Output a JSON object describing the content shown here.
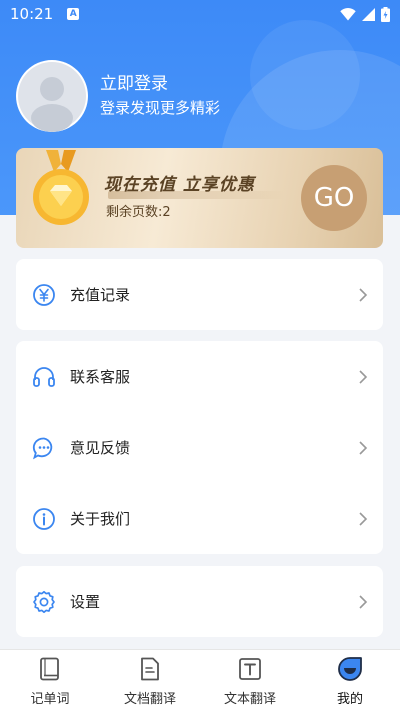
{
  "status_bar": {
    "time": "10:21",
    "notif_letter": "A"
  },
  "profile": {
    "title": "立即登录",
    "subtitle": "登录发现更多精彩"
  },
  "vip": {
    "headline": "现在充值 立享优惠",
    "pages_text": "剩余页数:2",
    "go_label": "GO"
  },
  "menu_card1": [
    {
      "label": "充值记录",
      "icon": "yen-circle-icon"
    }
  ],
  "menu_card2": [
    {
      "label": "联系客服",
      "icon": "headset-icon"
    },
    {
      "label": "意见反馈",
      "icon": "chat-bubble-icon"
    },
    {
      "label": "关于我们",
      "icon": "info-circle-icon"
    }
  ],
  "menu_card3": [
    {
      "label": "设置",
      "icon": "gear-icon"
    }
  ],
  "tabbar": [
    {
      "label": "记单词",
      "icon": "book-icon"
    },
    {
      "label": "文档翻译",
      "icon": "document-icon"
    },
    {
      "label": "文本翻译",
      "icon": "text-icon"
    },
    {
      "label": "我的",
      "icon": "profile-face-icon",
      "active": true
    }
  ],
  "colors": {
    "primary": "#3d8af7",
    "gold": "#c79f73",
    "icon_blue": "#3b86f0"
  }
}
